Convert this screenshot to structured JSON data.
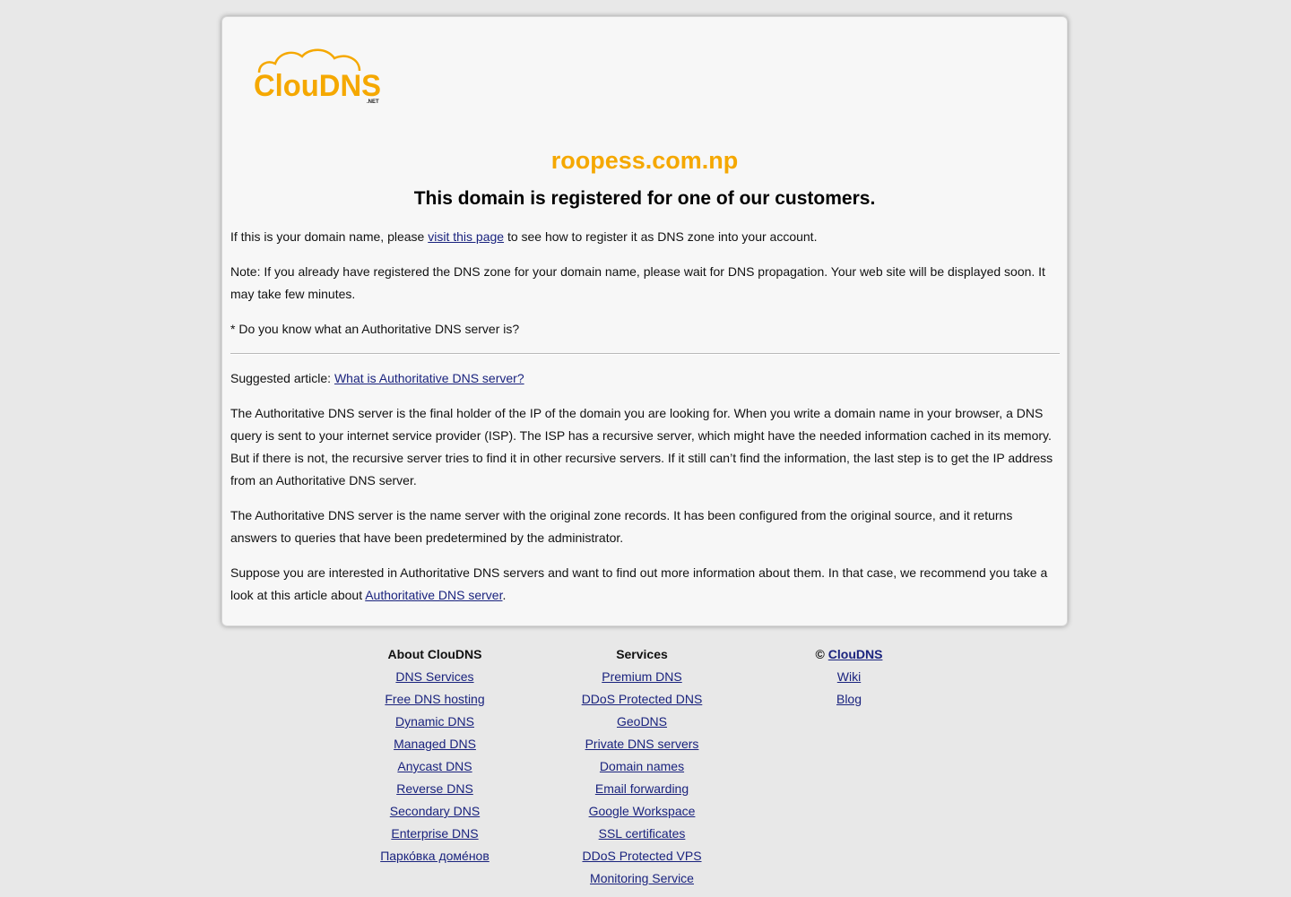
{
  "logo": {
    "text": "ClouDNS",
    "suffix": ".NET"
  },
  "domain": "roopess.com.np",
  "headline": "This domain is registered for one of our customers.",
  "para1": {
    "before": "If this is your domain name, please ",
    "link": "visit this page",
    "after": " to see how to register it as DNS zone into your account."
  },
  "para2": "Note: If you already have registered the DNS zone for your domain name, please wait for DNS propagation. Your web site will be displayed soon. It may take few minutes.",
  "para3": "* Do you know what an Authoritative DNS server is?",
  "suggested": {
    "label": "Suggested article: ",
    "link": "What is Authoritative DNS server?"
  },
  "para4": "The Authoritative DNS server is the final holder of the IP of the domain you are looking for. When you write a domain name in your browser, a DNS query is sent to your internet service provider (ISP). The ISP has a recursive server, which might have the needed information cached in its memory. But if there is not, the recursive server tries to find it in other recursive servers. If it still can’t find the information, the last step is to get the IP address from an Authoritative DNS server.",
  "para5": "The Authoritative DNS server is the name server with the original zone records. It has been configured from the original source, and it returns answers to queries that have been predetermined by the administrator.",
  "para6": {
    "before": "Suppose you are interested in Authoritative DNS servers and want to find out more information about them. In that case, we recommend you take a look at this article about ",
    "link": "Authoritative DNS server",
    "after": "."
  },
  "footer": {
    "about": {
      "title": "About ClouDNS",
      "links": [
        "DNS Services",
        "Free DNS hosting",
        "Dynamic DNS",
        "Managed DNS",
        "Anycast DNS",
        "Reverse DNS",
        "Secondary DNS",
        "Enterprise DNS",
        "Парко́вка доме́нов"
      ]
    },
    "services": {
      "title": "Services",
      "links": [
        "Premium DNS",
        "DDoS Protected DNS",
        "GeoDNS",
        "Private DNS servers",
        "Domain names",
        "Email forwarding",
        "Google Workspace",
        "SSL certificates",
        "DDoS Protected VPS",
        "Monitoring Service"
      ]
    },
    "brand": {
      "copyright": "© ",
      "title_link": "ClouDNS",
      "links": [
        "Wiki",
        "Blog"
      ]
    }
  },
  "colors": {
    "accent": "#f5a800",
    "link": "#1a237e",
    "background": "#e8e8e8",
    "card": "#f7f7f7"
  }
}
